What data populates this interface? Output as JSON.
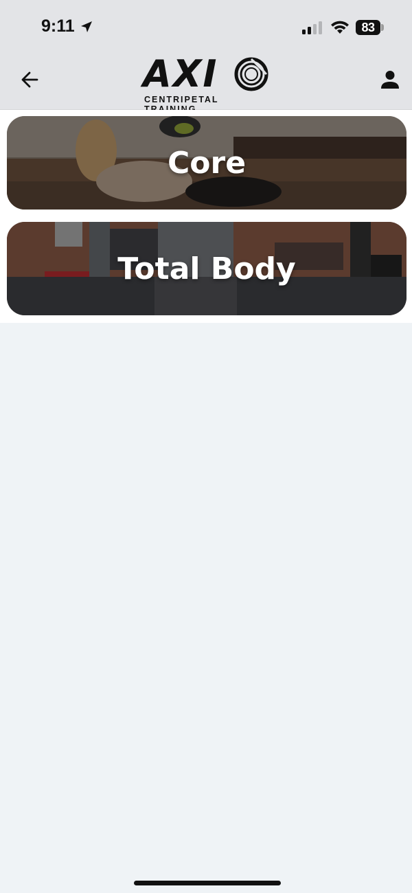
{
  "status_bar": {
    "time": "9:11",
    "battery": "83",
    "icons": [
      "location-arrow-icon",
      "signal-icon",
      "wifi-icon",
      "battery-icon"
    ]
  },
  "header": {
    "logo_text": "AXI",
    "logo_subtitle": "CENTRIPETAL TRAINING",
    "back_icon": "arrow-left-icon",
    "profile_icon": "person-icon"
  },
  "categories": [
    {
      "label": "Core"
    },
    {
      "label": "Total Body"
    }
  ],
  "colors": {
    "header_bg": "#e3e4e7",
    "page_bg": "#eff3f6",
    "text_primary": "#111111",
    "card_text": "#ffffff"
  }
}
